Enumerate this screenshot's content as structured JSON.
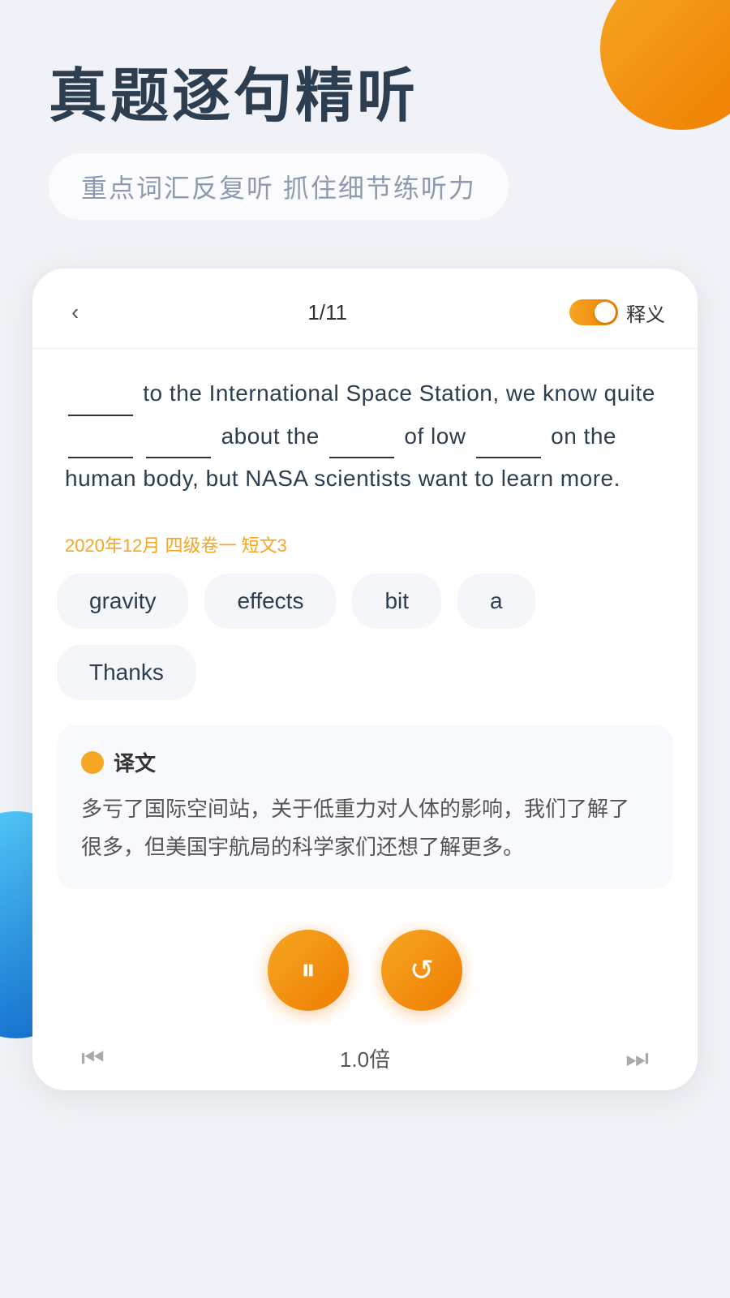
{
  "app": {
    "background_color": "#f0f2f7",
    "accent_color": "#f5a623"
  },
  "header": {
    "main_title": "真题逐句精听",
    "subtitle": "重点词汇反复听  抓住细节练听力"
  },
  "card": {
    "nav": {
      "back_icon": "‹",
      "counter": "1/11",
      "toggle_label": "释义",
      "toggle_active": true
    },
    "sentence": {
      "parts": [
        "_______ to the International Space Station, we know quite _______ _______ about the _______ of low _______ on the human body, but NASA scientists want to learn more."
      ],
      "source": "2020年12月 四级卷一 短文3"
    },
    "word_options": [
      {
        "label": "gravity"
      },
      {
        "label": "effects"
      },
      {
        "label": "bit"
      },
      {
        "label": "a"
      },
      {
        "label": "Thanks"
      }
    ],
    "translation": {
      "icon_color": "#f5a623",
      "title": "译文",
      "text": "多亏了国际空间站，关于低重力对人体的影响，我们了解了很多，但美国宇航局的科学家们还想了解更多。"
    },
    "controls": {
      "play_icon": "⏸",
      "replay_icon": "↺"
    },
    "bottom_bar": {
      "prev_icon": "⏮",
      "speed": "1.0倍",
      "next_icon": "⏭"
    }
  }
}
